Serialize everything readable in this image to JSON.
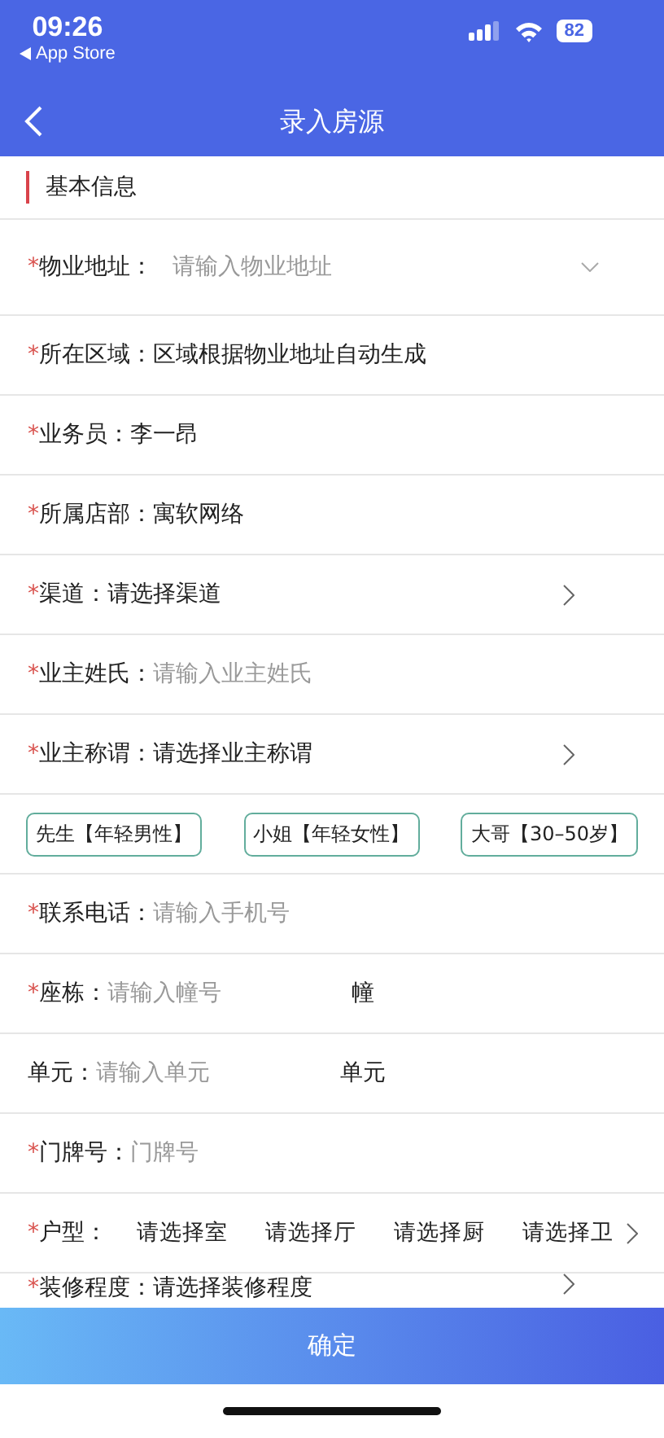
{
  "status_bar": {
    "time": "09:26",
    "back_app": "App Store",
    "battery": "82"
  },
  "nav": {
    "title": "录入房源"
  },
  "section": {
    "title": "基本信息"
  },
  "rows": [
    {
      "kind": "select",
      "mark": "*",
      "label": "物业地址：",
      "placeholder": "请输入物业地址"
    },
    {
      "kind": "text",
      "mark": "*",
      "label": "所在区域：",
      "value": "区域根据物业地址自动生成"
    },
    {
      "kind": "text",
      "mark": "*",
      "label": "业务员：",
      "value": "李一昂"
    },
    {
      "kind": "text",
      "mark": "*",
      "label": "所属店部：",
      "value": "寓软网络"
    },
    {
      "kind": "link",
      "mark": "*",
      "label": "渠道：",
      "value": "请选择渠道"
    },
    {
      "kind": "input",
      "mark": "*",
      "label": "业主姓氏：",
      "placeholder": "请输入业主姓氏"
    },
    {
      "kind": "link",
      "mark": "*",
      "label": "业主称谓：",
      "value": "请选择业主称谓"
    },
    {
      "kind": "tags",
      "tags": [
        "先生【年轻男性】",
        "小姐【年轻女性】",
        "大哥【30–50岁】"
      ]
    },
    {
      "kind": "input",
      "mark": "*",
      "label": "联系电话：",
      "placeholder": "请输入手机号"
    },
    {
      "kind": "suffix",
      "mark": "*",
      "label": "座栋：",
      "placeholder": "请输入幢号",
      "suffix": "幢"
    },
    {
      "kind": "suffix",
      "label": "单元：",
      "placeholder": "请输入单元",
      "suffix": "单元"
    },
    {
      "kind": "input",
      "mark": "*",
      "label": "门牌号：",
      "placeholder": "门牌号"
    },
    {
      "kind": "multi",
      "mark": "*",
      "label": "户型：",
      "options": [
        "请选择室",
        "请选择厅",
        "请选择厨",
        "请选择卫"
      ]
    },
    {
      "kind": "partial",
      "mark": "*",
      "label": "装修程度：",
      "value": "请选择装修程度"
    }
  ],
  "confirm_button": "确定"
}
